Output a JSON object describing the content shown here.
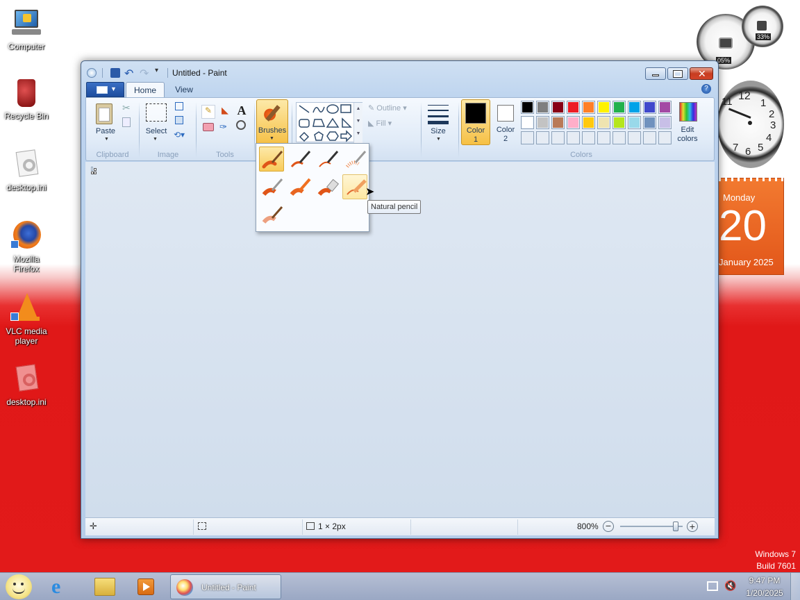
{
  "desktop": {
    "icons": [
      {
        "label": "Computer"
      },
      {
        "label": "Recycle Bin"
      },
      {
        "label": "desktop.ini"
      },
      {
        "label": "Mozilla Firefox"
      },
      {
        "label": "VLC media player"
      },
      {
        "label": "desktop.ini"
      }
    ],
    "watermark": {
      "line1": "Windows 7",
      "line2": "Build 7601"
    }
  },
  "gadgets": {
    "cpu_meter": {
      "cpu": "05%",
      "memory": "33%"
    },
    "clock": {
      "numbers": [
        "12",
        "1",
        "2",
        "3",
        "4",
        "5",
        "6",
        "7",
        "8",
        "9",
        "10",
        "11"
      ]
    },
    "calendar": {
      "weekday": "Monday",
      "day": "20",
      "month_year": "January 2025"
    }
  },
  "window": {
    "title": "Untitled - Paint",
    "tabs": [
      {
        "label": "Home"
      },
      {
        "label": "View"
      }
    ],
    "ribbon": {
      "clipboard": {
        "paste": "Paste",
        "group": "Clipboard"
      },
      "image": {
        "select": "Select",
        "group": "Image"
      },
      "tools": {
        "group": "Tools",
        "text_tool": "A"
      },
      "brushes": {
        "label": "Brushes"
      },
      "shapes": {
        "outline": "Outline",
        "fill": "Fill"
      },
      "size": {
        "label": "Size"
      },
      "colors": {
        "color1_label": "Color",
        "color1_num": "1",
        "color2_label": "Color",
        "color2_num": "2",
        "edit_label": "Edit",
        "edit_label2": "colors",
        "group": "Colors",
        "color1": "#000000",
        "color2": "#ffffff",
        "palette_row1": [
          "#000000",
          "#7f7f7f",
          "#880015",
          "#ed1c24",
          "#ff7f27",
          "#fff200",
          "#22b14c",
          "#00a2e8",
          "#3f48cc",
          "#a349a4"
        ],
        "palette_row2": [
          "#ffffff",
          "#c3c3c3",
          "#b97a57",
          "#ffaec9",
          "#ffc90e",
          "#efe4b0",
          "#b5e61d",
          "#99d9ea",
          "#7092be",
          "#c8bfe7"
        ]
      }
    },
    "brushes_menu": {
      "tooltip": "Natural pencil"
    },
    "status": {
      "image_size": "1 × 2px",
      "zoom": "800%"
    }
  },
  "taskbar": {
    "task_label": "Untitled - Paint",
    "time": "9:47 PM",
    "date": "1/20/2025"
  }
}
